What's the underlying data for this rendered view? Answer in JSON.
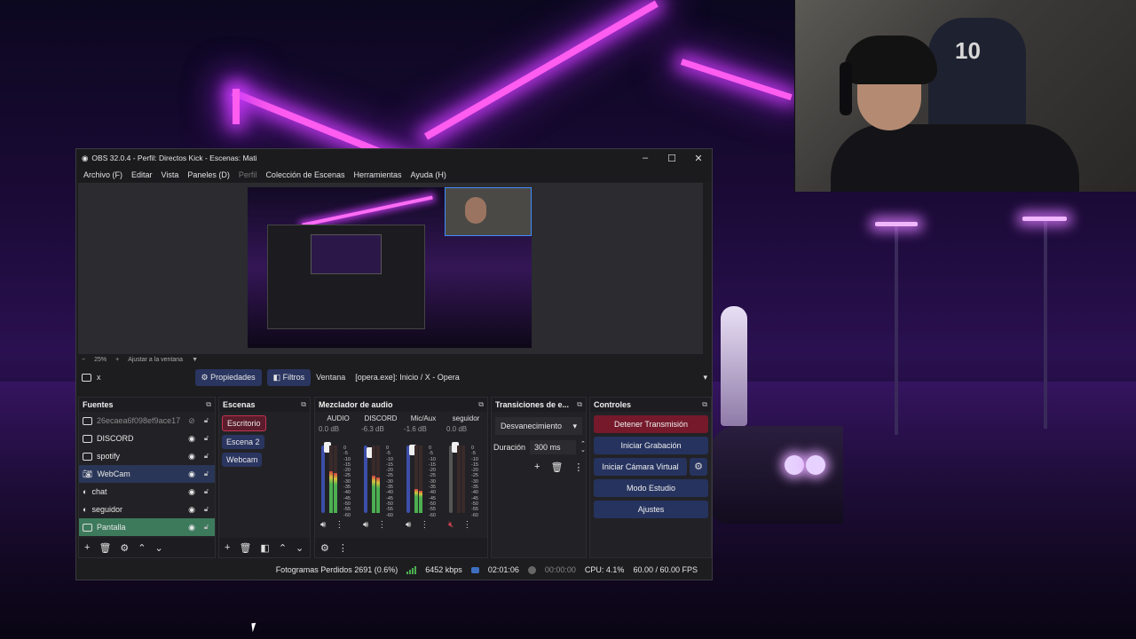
{
  "window": {
    "title": "OBS 32.0.4 - Perfil: Directos Kick - Escenas: Mati",
    "controls": [
      "–",
      "☐",
      "✕"
    ]
  },
  "menu": [
    "Archivo (F)",
    "Editar",
    "Vista",
    "Paneles (D)",
    "Perfil",
    "Colección de Escenas",
    "Herramientas",
    "Ayuda (H)"
  ],
  "zoom": {
    "minus": "−",
    "value": "25%",
    "plus": "+",
    "fit": "Ajustar a la ventana",
    "dropdown": "▼"
  },
  "source_toolbar": {
    "close": "x",
    "properties": "Propiedades",
    "filters": "Filtros",
    "window_label": "Ventana",
    "window_value": "[opera.exe]: Inicio / X - Opera"
  },
  "sources": {
    "title": "Fuentes",
    "items": [
      {
        "name": "26ecaea6f098ef9ace17",
        "icon": "window-icon",
        "visible": false
      },
      {
        "name": "DISCORD",
        "icon": "window-icon",
        "visible": true
      },
      {
        "name": "spotify",
        "icon": "window-icon",
        "visible": true
      },
      {
        "name": "WebCam",
        "icon": "camera-icon",
        "visible": true
      },
      {
        "name": "chat",
        "icon": "globe-icon",
        "visible": true
      },
      {
        "name": "seguidor",
        "icon": "globe-icon",
        "visible": true
      },
      {
        "name": "Pantalla",
        "icon": "monitor-icon",
        "visible": true
      }
    ]
  },
  "scenes": {
    "title": "Escenas",
    "items": [
      "Escritorio",
      "Escena 2",
      "Webcam"
    ],
    "active": "Escritorio"
  },
  "mixer": {
    "title": "Mezclador de audio",
    "channels": [
      {
        "name": "AUDIO",
        "db": "0.0 dB",
        "level": 0.62,
        "fader": 1.0
      },
      {
        "name": "DISCORD",
        "db": "-6.3 dB",
        "level": 0.55,
        "fader": 0.9
      },
      {
        "name": "Mic/Aux",
        "db": "-1.6 dB",
        "level": 0.35,
        "fader": 0.95
      },
      {
        "name": "seguidor",
        "db": "0.0 dB",
        "level": 0.0,
        "fader": 1.0,
        "muted": true
      }
    ],
    "scale": [
      "0",
      "-5",
      "-10",
      "-15",
      "-20",
      "-25",
      "-30",
      "-35",
      "-40",
      "-45",
      "-50",
      "-55",
      "-60"
    ]
  },
  "transitions": {
    "title": "Transiciones de e...",
    "selected": "Desvanecimiento",
    "duration_label": "Duración",
    "duration_value": "300 ms"
  },
  "controls": {
    "title": "Controles",
    "stop_stream": "Detener Transmisión",
    "start_recording": "Iniciar Grabación",
    "start_virtual_cam": "Iniciar Cámara Virtual",
    "studio_mode": "Modo Estudio",
    "settings": "Ajustes"
  },
  "status": {
    "dropped_frames": "Fotogramas Perdidos 2691 (0.6%)",
    "bitrate": "6452 kbps",
    "stream_time": "02:01:06",
    "rec_time": "00:00:00",
    "cpu": "CPU: 4.1%",
    "fps": "60.00 / 60.00 FPS"
  },
  "webcam_overlay": {
    "chair_number": "10"
  },
  "colors": {
    "accent_blue": "#2a3560",
    "stop_red": "#75192b",
    "selected_green": "#3d7a5c"
  }
}
